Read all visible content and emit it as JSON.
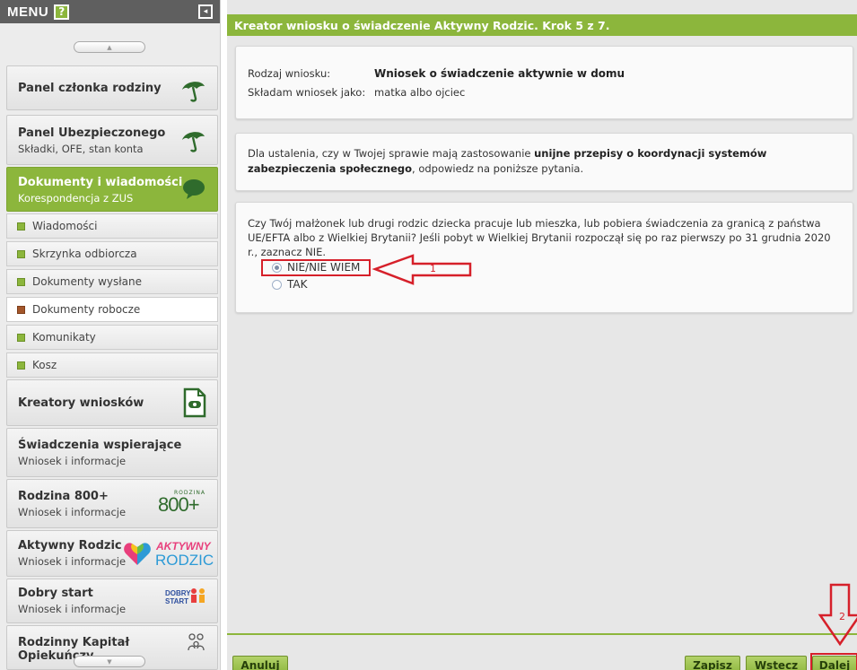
{
  "sidebar": {
    "menu_title": "MENU",
    "help_label": "?",
    "collapse_label": "◂",
    "scroll_up_label": "▲",
    "scroll_down_label": "▼",
    "panels": [
      {
        "title": "Panel członka rodziny",
        "subtitle": "",
        "icon": "umbrella-icon"
      },
      {
        "title": "Panel Ubezpieczonego",
        "subtitle": "Składki, OFE, stan konta",
        "icon": "umbrella-icon"
      },
      {
        "title": "Dokumenty i wiadomości",
        "subtitle": "Korespondencja z ZUS",
        "icon": "speech-bubble-icon",
        "active": true
      },
      {
        "title": "Kreatory wniosków",
        "subtitle": "",
        "icon": "document-icon"
      },
      {
        "title": "Świadczenia wspierające",
        "subtitle": "Wniosek i informacje"
      },
      {
        "title": "Rodzina 800+",
        "subtitle": "Wniosek i informacje",
        "icon": "rodzina-800-logo",
        "logo_text": "800+",
        "logo_small": "RODZINA"
      },
      {
        "title": "Aktywny Rodzic",
        "subtitle": "Wniosek i informacje",
        "icon": "aktywny-rodzic-logo",
        "logo_line1": "AKTYWNY",
        "logo_line2": "RODZIC"
      },
      {
        "title": "Dobry start",
        "subtitle": "Wniosek i informacje",
        "icon": "dobry-start-logo",
        "logo_line1": "DOBRY",
        "logo_line2": "START"
      },
      {
        "title": "Rodzinny Kapitał Opiekuńczy",
        "subtitle": "",
        "icon": "family-icon"
      }
    ],
    "subitems": [
      {
        "label": "Wiadomości"
      },
      {
        "label": "Skrzynka odbiorcza"
      },
      {
        "label": "Dokumenty wysłane"
      },
      {
        "label": "Dokumenty robocze",
        "selected": true
      },
      {
        "label": "Komunikaty"
      },
      {
        "label": "Kosz"
      }
    ]
  },
  "main": {
    "header": "Kreator wniosku o świadczenie Aktywny Rodzic. Krok 5 z 7.",
    "info": {
      "type_label": "Rodzaj wniosku:",
      "type_value": "Wniosek o świadczenie aktywnie w domu",
      "as_label": "Składam wniosek jako:",
      "as_value": "matka albo ojciec"
    },
    "coordination": {
      "text_before": "Dla ustalenia, czy w Twojej sprawie mają zastosowanie ",
      "text_bold": "unijne przepisy o koordynacji systemów zabezpieczenia społecznego",
      "text_after": ", odpowiedz na poniższe pytania."
    },
    "question": {
      "text": "Czy Twój małżonek lub drugi rodzic dziecka pracuje lub mieszka, lub pobiera świadczenia za granicą z państwa UE/EFTA albo z Wielkiej Brytanii? Jeśli pobyt w Wielkiej Brytanii rozpoczął się po raz pierwszy po 31 grudnia 2020 r., zaznacz NIE.",
      "options": [
        {
          "label": "NIE/NIE WIEM",
          "selected": true
        },
        {
          "label": "TAK",
          "selected": false
        }
      ]
    },
    "annotations": {
      "arrow1": "1",
      "arrow2": "2"
    },
    "buttons": {
      "cancel": "Anuluj",
      "save": "Zapisz",
      "back": "Wstecz",
      "next": "Dalej"
    }
  },
  "colors": {
    "accent": "#8cb63c",
    "annotation_red": "#d6202a",
    "selected_square": "#a3562a"
  }
}
